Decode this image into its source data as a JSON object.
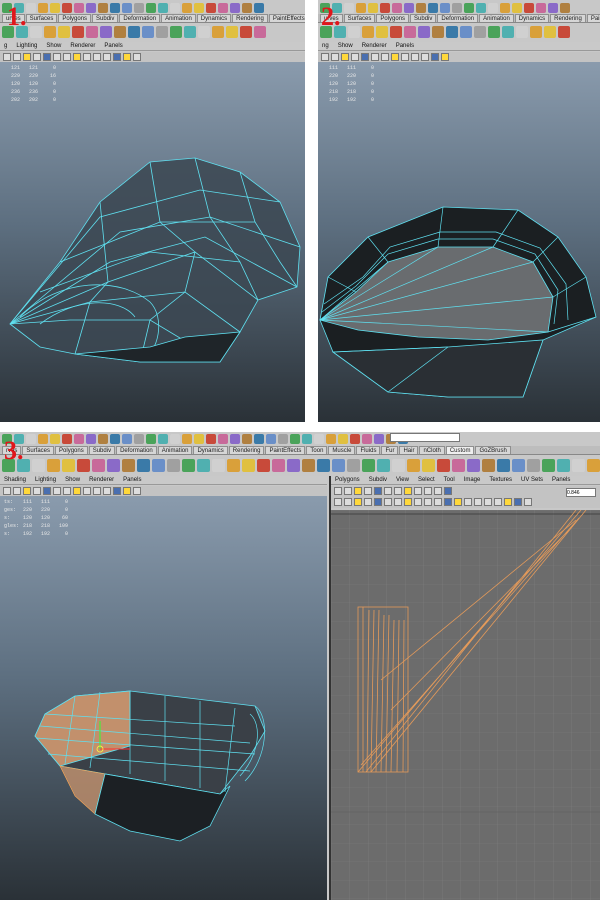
{
  "panel1": {
    "step_label": "1.",
    "shelf_tabs": [
      "urves",
      "Surfaces",
      "Polygons",
      "Subdiv",
      "Deformation",
      "Animation",
      "Dynamics",
      "Rendering",
      "PaintEffects",
      "Toon",
      "Musc"
    ],
    "active_tab": "",
    "menu": [
      "g",
      "Lighting",
      "Show",
      "Renderer",
      "Panels"
    ],
    "stats": [
      [
        "121",
        "121",
        "0"
      ],
      [
        "229",
        "229",
        "16"
      ],
      [
        "120",
        "120",
        "0"
      ],
      [
        "236",
        "236",
        "0"
      ],
      [
        "202",
        "202",
        "0"
      ]
    ]
  },
  "panel2": {
    "step_label": "2.",
    "shelf_tabs": [
      "urves",
      "Surfaces",
      "Polygons",
      "Subdiv",
      "Deformation",
      "Animation",
      "Dynamics",
      "Rendering",
      "PaintEffects",
      "Toon",
      "Muscl"
    ],
    "menu": [
      "ng",
      "Show",
      "Renderer",
      "Panels"
    ],
    "stats": [
      [
        "111",
        "111",
        "0"
      ],
      [
        "220",
        "220",
        "0"
      ],
      [
        "120",
        "120",
        "0"
      ],
      [
        "218",
        "218",
        "0"
      ],
      [
        "192",
        "192",
        "0"
      ]
    ]
  },
  "panel3": {
    "step_label": "3.",
    "shelf_tabs": [
      "rves",
      "Surfaces",
      "Polygons",
      "Subdiv",
      "Deformation",
      "Animation",
      "Dynamics",
      "Rendering",
      "PaintEffects",
      "Toon",
      "Muscle",
      "Fluids",
      "Fur",
      "Hair",
      "nCloth",
      "Custom",
      "GoZBrush"
    ],
    "active_tab": "Custom",
    "menu": [
      "Shading",
      "Lighting",
      "Show",
      "Renderer",
      "Panels"
    ],
    "stat_labels": [
      "ts:",
      "ges:",
      "s:",
      "gles:",
      "s:"
    ],
    "stats": [
      [
        "111",
        "111",
        "0"
      ],
      [
        "220",
        "220",
        "0"
      ],
      [
        "120",
        "120",
        "60"
      ],
      [
        "218",
        "218",
        "109"
      ],
      [
        "192",
        "192",
        "0"
      ]
    ],
    "uv_menu": [
      "Polygons",
      "Subdiv",
      "View",
      "Select",
      "Tool",
      "Image",
      "Textures",
      "UV Sets",
      "Panels"
    ],
    "uv_field": "0.846"
  }
}
